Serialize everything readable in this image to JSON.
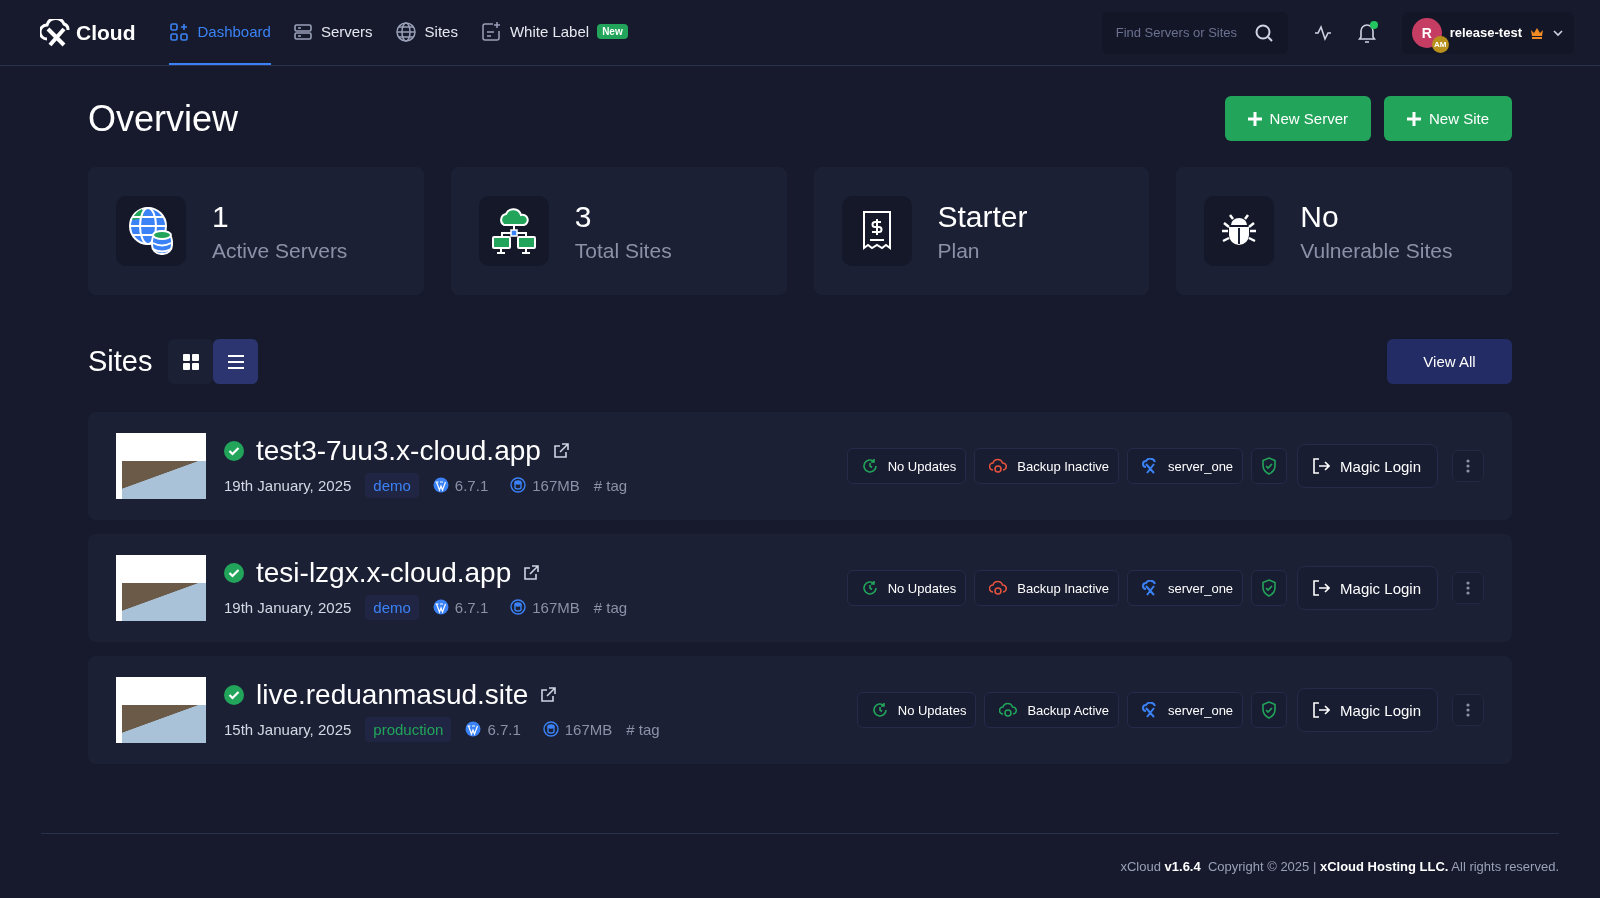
{
  "nav": {
    "logo": "Cloud",
    "items": [
      {
        "label": "Dashboard",
        "kind": "dashboard",
        "selected": true
      },
      {
        "label": "Servers",
        "kind": "servers",
        "selected": false
      },
      {
        "label": "Sites",
        "kind": "globe",
        "selected": false
      },
      {
        "label": "White Label",
        "kind": "label",
        "selected": false,
        "badge": "New"
      }
    ]
  },
  "search": {
    "placeholder": "Find Servers or Sites"
  },
  "notifications": {
    "unread": true
  },
  "user": {
    "initial": "R",
    "role_badge": "AM",
    "name": "release-test"
  },
  "page": {
    "title": "Overview",
    "actions": [
      "New Server",
      "New Site"
    ]
  },
  "stats": [
    {
      "value": "1",
      "label": "Active Servers",
      "kind": "globe-db"
    },
    {
      "value": "3",
      "label": "Total Sites",
      "kind": "network"
    },
    {
      "value": "Starter",
      "label": "Plan",
      "kind": "receipt"
    },
    {
      "value": "No",
      "label": "Vulnerable Sites",
      "kind": "bug"
    }
  ],
  "sites_section": {
    "title": "Sites",
    "views": [
      {
        "kind": "grid",
        "selected": false
      },
      {
        "kind": "list",
        "selected": true
      }
    ],
    "view_all": "View All"
  },
  "sites": [
    {
      "domain": "test3-7uu3.x-cloud.app",
      "online": true,
      "date": "19th January, 2025",
      "environment": {
        "label": "demo",
        "color": "#3b82f6"
      },
      "wp_version": "6.7.1",
      "size": "167MB",
      "tag": "# tag",
      "updates": "No Updates",
      "backup": {
        "label": "Backup Inactive",
        "active": false
      },
      "server": "server_one",
      "secure": true,
      "action": "Magic Login"
    },
    {
      "domain": "tesi-lzgx.x-cloud.app",
      "online": true,
      "date": "19th January, 2025",
      "environment": {
        "label": "demo",
        "color": "#3b82f6"
      },
      "wp_version": "6.7.1",
      "size": "167MB",
      "tag": "# tag",
      "updates": "No Updates",
      "backup": {
        "label": "Backup Inactive",
        "active": false
      },
      "server": "server_one",
      "secure": true,
      "action": "Magic Login"
    },
    {
      "domain": "live.reduanmasud.site",
      "online": true,
      "date": "15th January, 2025",
      "environment": {
        "label": "production",
        "color": "#22a55a"
      },
      "wp_version": "6.7.1",
      "size": "167MB",
      "tag": "# tag",
      "updates": "No Updates",
      "backup": {
        "label": "Backup Active",
        "active": true
      },
      "server": "server_one",
      "secure": true,
      "action": "Magic Login"
    }
  ],
  "footer": {
    "text": "xCloud **v1.6.4**  Copyright © 2025 | **xCloud Hosting LLC.** All rights reserved."
  }
}
